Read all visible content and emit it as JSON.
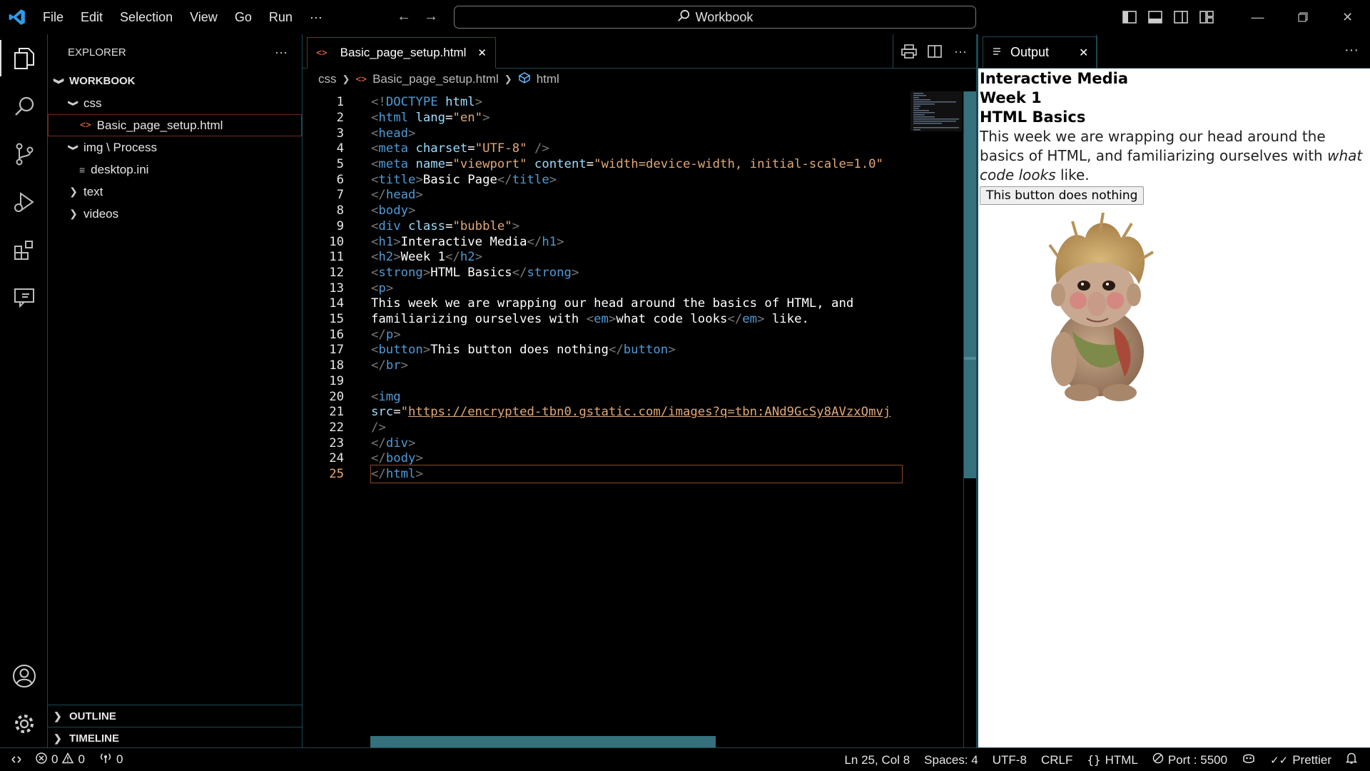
{
  "titlebar": {
    "menu": [
      "File",
      "Edit",
      "Selection",
      "View",
      "Go",
      "Run",
      "···"
    ],
    "command_center": "Workbook"
  },
  "sidebar": {
    "title": "EXPLORER",
    "more": "···",
    "tree": [
      {
        "label": "WORKBOOK",
        "chev": "v",
        "level": 0,
        "kind": "root"
      },
      {
        "label": "css",
        "chev": "v",
        "level": 1,
        "kind": "folder"
      },
      {
        "label": "Basic_page_setup.html",
        "chev": "",
        "level": 2,
        "kind": "html",
        "selected": true
      },
      {
        "label": "img \\ Process",
        "chev": "v",
        "level": 1,
        "kind": "folder"
      },
      {
        "label": "desktop.ini",
        "chev": "",
        "level": 2,
        "kind": "ini"
      },
      {
        "label": "text",
        "chev": ">",
        "level": 1,
        "kind": "folder"
      },
      {
        "label": "videos",
        "chev": ">",
        "level": 1,
        "kind": "folder"
      }
    ],
    "outline": "OUTLINE",
    "timeline": "TIMELINE"
  },
  "editor": {
    "tab_label": "Basic_page_setup.html",
    "breadcrumb": [
      "css",
      "Basic_page_setup.html",
      "html"
    ],
    "current_line": 25,
    "lines": [
      [
        [
          "p",
          "<!"
        ],
        [
          "t",
          "DOCTYPE"
        ],
        [
          "x",
          " "
        ],
        [
          "a",
          "html"
        ],
        [
          "p",
          ">"
        ]
      ],
      [
        [
          "p",
          "<"
        ],
        [
          "t",
          "html"
        ],
        [
          "x",
          " "
        ],
        [
          "a",
          "lang"
        ],
        [
          "x",
          "="
        ],
        [
          "s",
          "\"en\""
        ],
        [
          "p",
          ">"
        ]
      ],
      [
        [
          "p",
          "<"
        ],
        [
          "t",
          "head"
        ],
        [
          "p",
          ">"
        ]
      ],
      [
        [
          "p",
          "<"
        ],
        [
          "t",
          "meta"
        ],
        [
          "x",
          " "
        ],
        [
          "a",
          "charset"
        ],
        [
          "x",
          "="
        ],
        [
          "s",
          "\"UTF-8\""
        ],
        [
          "x",
          " "
        ],
        [
          "p",
          "/>"
        ]
      ],
      [
        [
          "p",
          "<"
        ],
        [
          "t",
          "meta"
        ],
        [
          "x",
          " "
        ],
        [
          "a",
          "name"
        ],
        [
          "x",
          "="
        ],
        [
          "s",
          "\"viewport\""
        ],
        [
          "x",
          " "
        ],
        [
          "a",
          "content"
        ],
        [
          "x",
          "="
        ],
        [
          "s",
          "\"width=device-width, initial-scale=1.0\""
        ]
      ],
      [
        [
          "p",
          "<"
        ],
        [
          "t",
          "title"
        ],
        [
          "p",
          ">"
        ],
        [
          "x",
          "Basic Page"
        ],
        [
          "p",
          "</"
        ],
        [
          "t",
          "title"
        ],
        [
          "p",
          ">"
        ]
      ],
      [
        [
          "p",
          "</"
        ],
        [
          "t",
          "head"
        ],
        [
          "p",
          ">"
        ]
      ],
      [
        [
          "p",
          "<"
        ],
        [
          "t",
          "body"
        ],
        [
          "p",
          ">"
        ]
      ],
      [
        [
          "p",
          "<"
        ],
        [
          "t",
          "div"
        ],
        [
          "x",
          " "
        ],
        [
          "a",
          "class"
        ],
        [
          "x",
          "="
        ],
        [
          "s",
          "\"bubble\""
        ],
        [
          "p",
          ">"
        ]
      ],
      [
        [
          "p",
          "<"
        ],
        [
          "t",
          "h1"
        ],
        [
          "p",
          ">"
        ],
        [
          "x",
          "Interactive Media"
        ],
        [
          "p",
          "</"
        ],
        [
          "t",
          "h1"
        ],
        [
          "p",
          ">"
        ]
      ],
      [
        [
          "p",
          "<"
        ],
        [
          "t",
          "h2"
        ],
        [
          "p",
          ">"
        ],
        [
          "x",
          "Week 1"
        ],
        [
          "p",
          "</"
        ],
        [
          "t",
          "h2"
        ],
        [
          "p",
          ">"
        ]
      ],
      [
        [
          "p",
          "<"
        ],
        [
          "t",
          "strong"
        ],
        [
          "p",
          ">"
        ],
        [
          "x",
          "HTML Basics"
        ],
        [
          "p",
          "</"
        ],
        [
          "t",
          "strong"
        ],
        [
          "p",
          ">"
        ]
      ],
      [
        [
          "p",
          "<"
        ],
        [
          "t",
          "p"
        ],
        [
          "p",
          ">"
        ]
      ],
      [
        [
          "x",
          "This week we are wrapping our head around the basics of HTML, and"
        ]
      ],
      [
        [
          "x",
          "familiarizing ourselves with "
        ],
        [
          "p",
          "<"
        ],
        [
          "t",
          "em"
        ],
        [
          "p",
          ">"
        ],
        [
          "x",
          "what code looks"
        ],
        [
          "p",
          "</"
        ],
        [
          "t",
          "em"
        ],
        [
          "p",
          ">"
        ],
        [
          "x",
          " like."
        ]
      ],
      [
        [
          "p",
          "</"
        ],
        [
          "t",
          "p"
        ],
        [
          "p",
          ">"
        ]
      ],
      [
        [
          "p",
          "<"
        ],
        [
          "t",
          "button"
        ],
        [
          "p",
          ">"
        ],
        [
          "x",
          "This button does nothing"
        ],
        [
          "p",
          "</"
        ],
        [
          "t",
          "button"
        ],
        [
          "p",
          ">"
        ]
      ],
      [
        [
          "p",
          "</"
        ],
        [
          "t",
          "br"
        ],
        [
          "p",
          ">"
        ]
      ],
      [],
      [
        [
          "p",
          "<"
        ],
        [
          "t",
          "img"
        ]
      ],
      [
        [
          "a",
          "src"
        ],
        [
          "x",
          "="
        ],
        [
          "s",
          "\""
        ],
        [
          "u",
          "https://encrypted-tbn0.gstatic.com/images?q=tbn:ANd9GcSy8AVzxQmvj"
        ]
      ],
      [
        [
          "p",
          "/>"
        ]
      ],
      [
        [
          "p",
          "</"
        ],
        [
          "t",
          "div"
        ],
        [
          "p",
          ">"
        ]
      ],
      [
        [
          "p",
          "</"
        ],
        [
          "t",
          "body"
        ],
        [
          "p",
          ">"
        ]
      ],
      [
        [
          "p",
          "</"
        ],
        [
          "t",
          "html"
        ],
        [
          "p",
          ">"
        ]
      ]
    ]
  },
  "output": {
    "tab_label": "Output",
    "more": "···",
    "page": {
      "h1": "Interactive Media",
      "h2": "Week 1",
      "strong": "HTML Basics",
      "p_before": "This week we are wrapping our head around the basics of HTML, and familiarizing ourselves with ",
      "p_em": "what code looks",
      "p_after": " like.",
      "button": "This button does nothing"
    }
  },
  "statusbar": {
    "errors": "0",
    "warnings": "0",
    "ports": "0",
    "position": "Ln 25, Col 8",
    "spaces": "Spaces: 4",
    "encoding": "UTF-8",
    "eol": "CRLF",
    "language": "HTML",
    "port": "Port : 5500",
    "prettier": "Prettier"
  },
  "colors": {
    "accent": "#1a4a52",
    "scrollbar": "#35707d",
    "html_icon": "#e8704a",
    "tag": "#4f9ad6",
    "attr": "#9cdcfe",
    "string": "#e0a878"
  }
}
